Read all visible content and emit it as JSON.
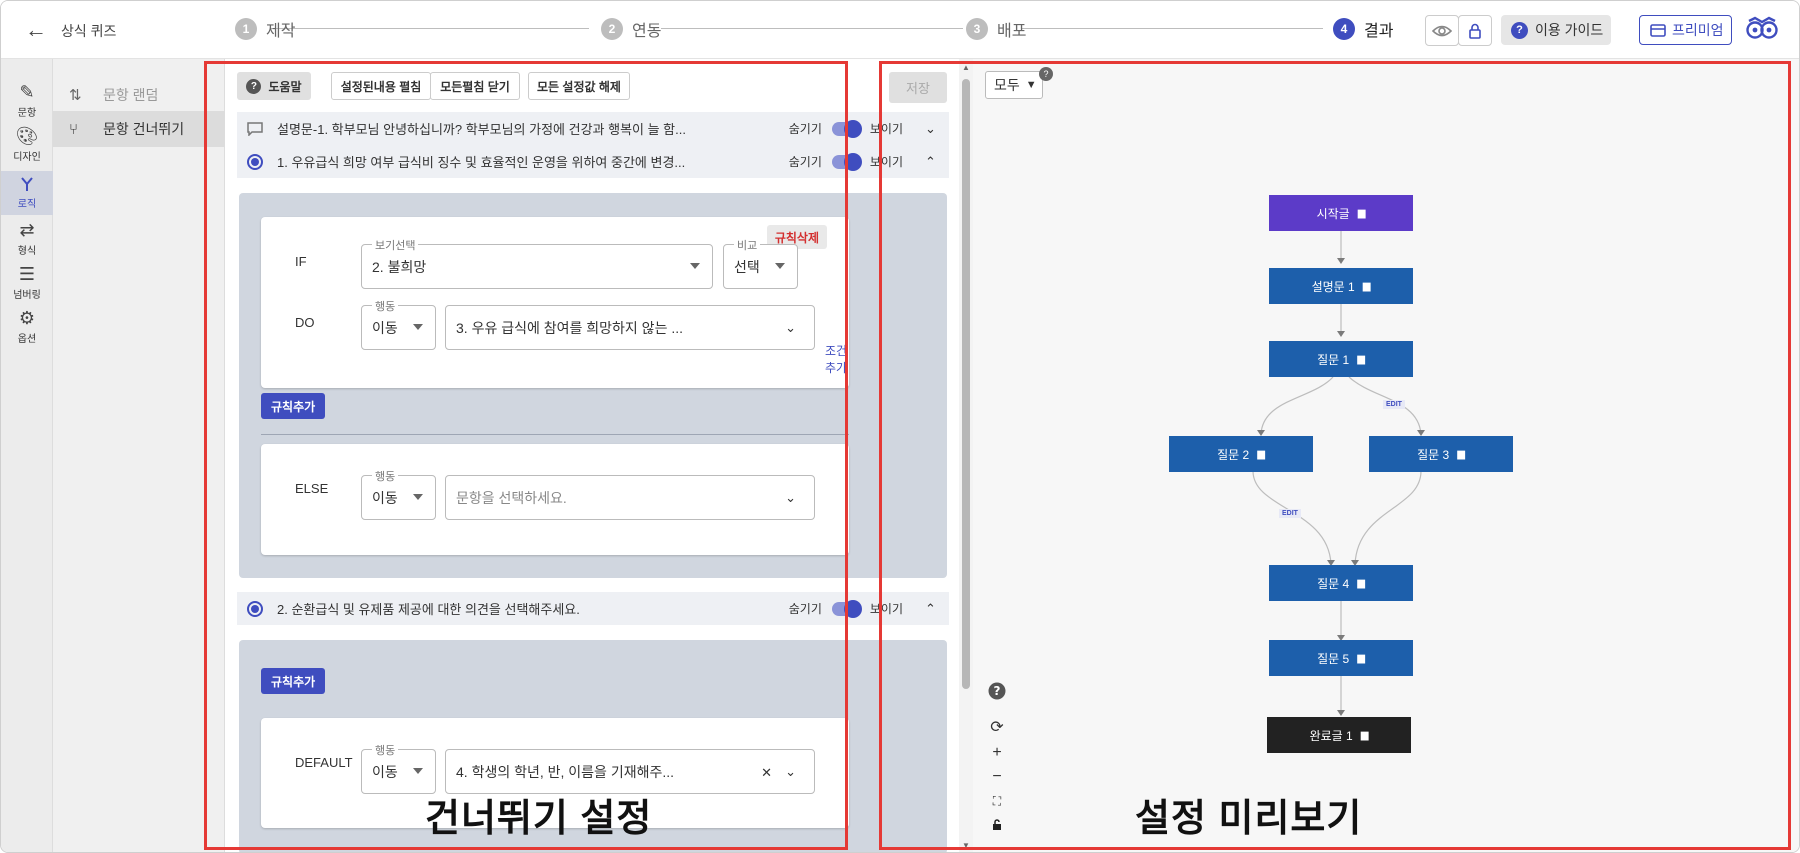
{
  "header": {
    "back_label": "←",
    "quiz_title": "상식 퀴즈",
    "steps": [
      {
        "num": "1",
        "label": "제작"
      },
      {
        "num": "2",
        "label": "연동"
      },
      {
        "num": "3",
        "label": "배포"
      },
      {
        "num": "4",
        "label": "결과"
      }
    ],
    "guide_label": "이용 가이드",
    "premium_label": "프리미엄"
  },
  "rail": [
    {
      "label": "문항",
      "icon": "pencil-icon"
    },
    {
      "label": "디자인",
      "icon": "palette-icon"
    },
    {
      "label": "로직",
      "icon": "branch-icon"
    },
    {
      "label": "형식",
      "icon": "swap-icon"
    },
    {
      "label": "넘버링",
      "icon": "list-icon"
    },
    {
      "label": "옵션",
      "icon": "gear-icon"
    }
  ],
  "submenu": [
    {
      "label": "문항 랜덤",
      "icon": "shuffle-icon"
    },
    {
      "label": "문항 건너뛰기",
      "icon": "skip-icon"
    }
  ],
  "toolbar": {
    "help": "도움말",
    "expand": "설정된내용 펼침",
    "collapse": "모든펼침 닫기",
    "reset": "모든 설정값 해제",
    "save": "저장"
  },
  "questions": [
    {
      "text": "설명문-1. 학부모님 안녕하십니까? 학부모님의 가정에 건강과 행복이 늘 함...",
      "hide": "숨기기",
      "show": "보이기"
    },
    {
      "text": "1. 우유급식 희망 여부 급식비 징수 및 효율적인 운영을 위하여 중간에 변경...",
      "hide": "숨기기",
      "show": "보이기"
    },
    {
      "text": "2. 순환급식 및 유제품 제공에 대한 의견을 선택해주세요.",
      "hide": "숨기기",
      "show": "보이기"
    }
  ],
  "rule1": {
    "delete": "규칙삭제",
    "if_label": "IF",
    "choice_legend": "보기선택",
    "choice_value": "2. 불희망",
    "compare_legend": "비교",
    "compare_value": "선택",
    "do_label": "DO",
    "action_legend": "행동",
    "action_value": "이동",
    "target_value": "3. 우유 급식에 참여를 희망하지 않는 ...",
    "add_condition": "조건추가",
    "add_rule": "규칙추가",
    "else_label": "ELSE",
    "else_action_legend": "행동",
    "else_action_value": "이동",
    "else_target_placeholder": "문항을 선택하세요."
  },
  "rule2": {
    "add_rule": "규칙추가",
    "default_label": "DEFAULT",
    "action_legend": "행동",
    "action_value": "이동",
    "target_value": "4. 학생의 학년, 반, 이름을 기재해주..."
  },
  "preview": {
    "mode": "모두",
    "nodes": [
      {
        "label": "시작글",
        "color": "#5c3bc8"
      },
      {
        "label": "설명문 1",
        "color": "#1d5fab"
      },
      {
        "label": "질문 1",
        "color": "#1d5fab"
      },
      {
        "label": "질문 2",
        "color": "#1d5fab"
      },
      {
        "label": "질문 3",
        "color": "#1d5fab"
      },
      {
        "label": "질문 4",
        "color": "#1d5fab"
      },
      {
        "label": "질문 5",
        "color": "#1d5fab"
      },
      {
        "label": "완료글 1",
        "color": "#222222"
      }
    ],
    "edge_label": "EDIT"
  },
  "overlays": {
    "left": "건너뛰기 설정",
    "right": "설정 미리보기"
  }
}
